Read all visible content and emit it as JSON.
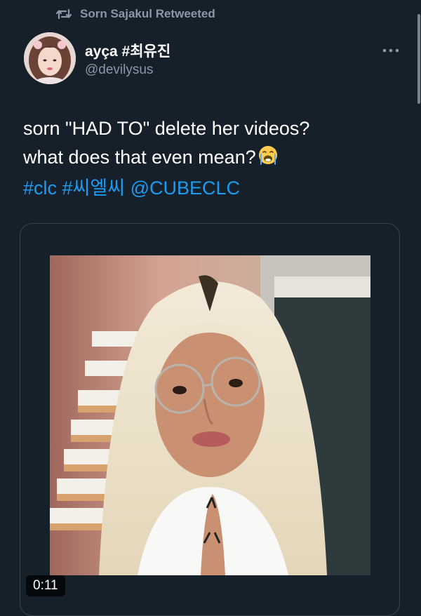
{
  "retweet": {
    "icon": "retweet-icon",
    "label": "Sorn Sajakul Retweeted"
  },
  "tweet": {
    "author": {
      "display_name": "ayça #최유진",
      "handle": "@devilysus",
      "avatar": "avatar-photo"
    },
    "more_icon": "more-horizontal-icon",
    "text_line_1": "sorn \"HAD TO\" delete her videos?",
    "text_line_2": "what does that even mean?",
    "emoji": "loudly-crying-face",
    "hashtags": [
      "#clc",
      "#씨엘씨"
    ],
    "mention": "@CUBECLC"
  },
  "media": {
    "type": "video",
    "duration": "0:11"
  },
  "colors": {
    "background": "#15202b",
    "text": "#ffffff",
    "secondary_text": "#8b98a5",
    "link": "#1d9bf0",
    "border": "#38444d"
  }
}
